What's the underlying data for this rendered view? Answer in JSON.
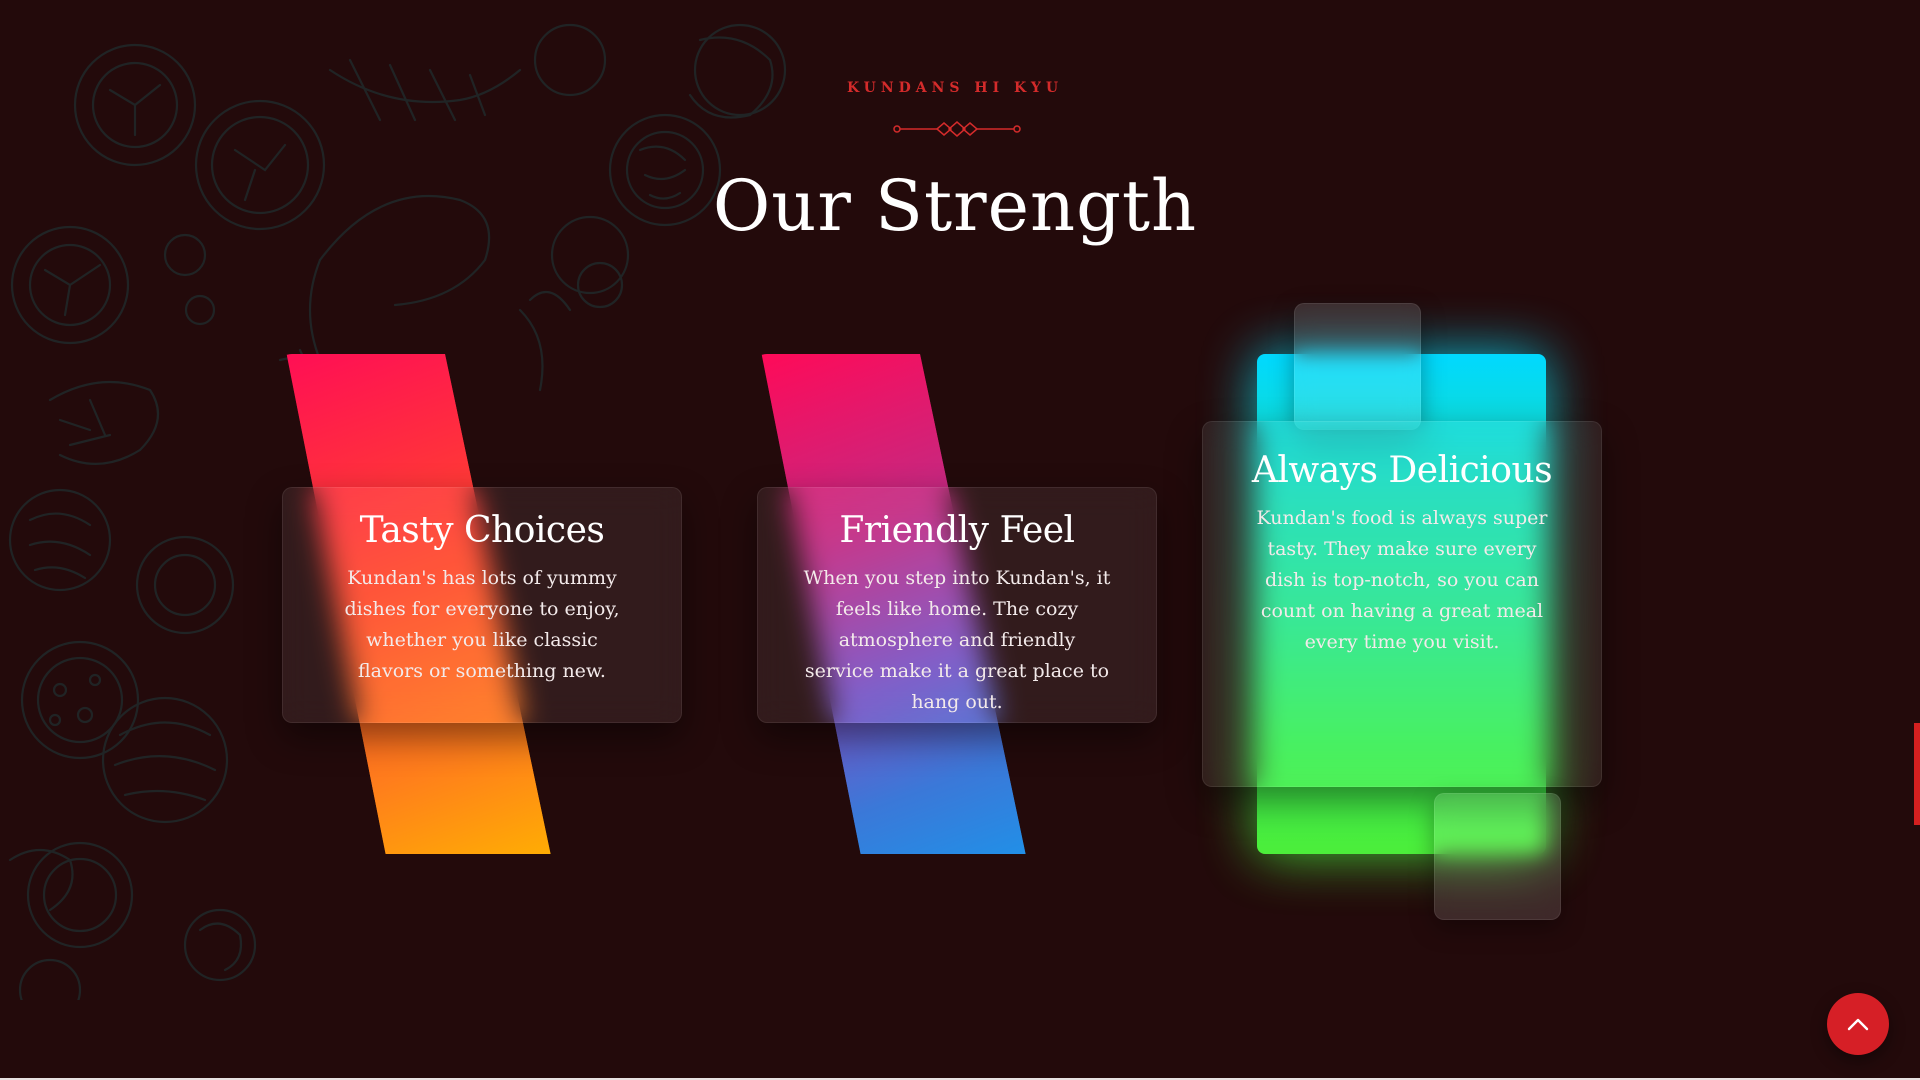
{
  "section": {
    "eyebrow": "KUNDANS HI KYU",
    "title": "Our Strength"
  },
  "cards": [
    {
      "title": "Tasty Choices",
      "text": "Kundan's has lots of yummy dishes for everyone to enjoy, whether you like classic flavors or something new."
    },
    {
      "title": "Friendly Feel",
      "text": "When you step into Kundan's, it feels like home. The cozy atmosphere and friendly service make it a great place to hang out."
    },
    {
      "title": "Always Delicious",
      "text": "Kundan's food is always super tasty. They make sure every dish is top-notch, so you can count on having a great meal every time you visit."
    }
  ],
  "colors": {
    "background": "#230a0b",
    "accent": "#d42b2b",
    "card1_gradient": [
      "#ff0e55",
      "#ff7d1c",
      "#ffb400"
    ],
    "card2_gradient": [
      "#ff0a58",
      "#7a52c4",
      "#1c94ea"
    ],
    "card3_gradient": [
      "#00d9ff",
      "#2ce88a",
      "#4cee3a"
    ]
  },
  "icons": {
    "divider": "ornament-divider-icon",
    "scroll_top": "chevron-up-icon"
  }
}
